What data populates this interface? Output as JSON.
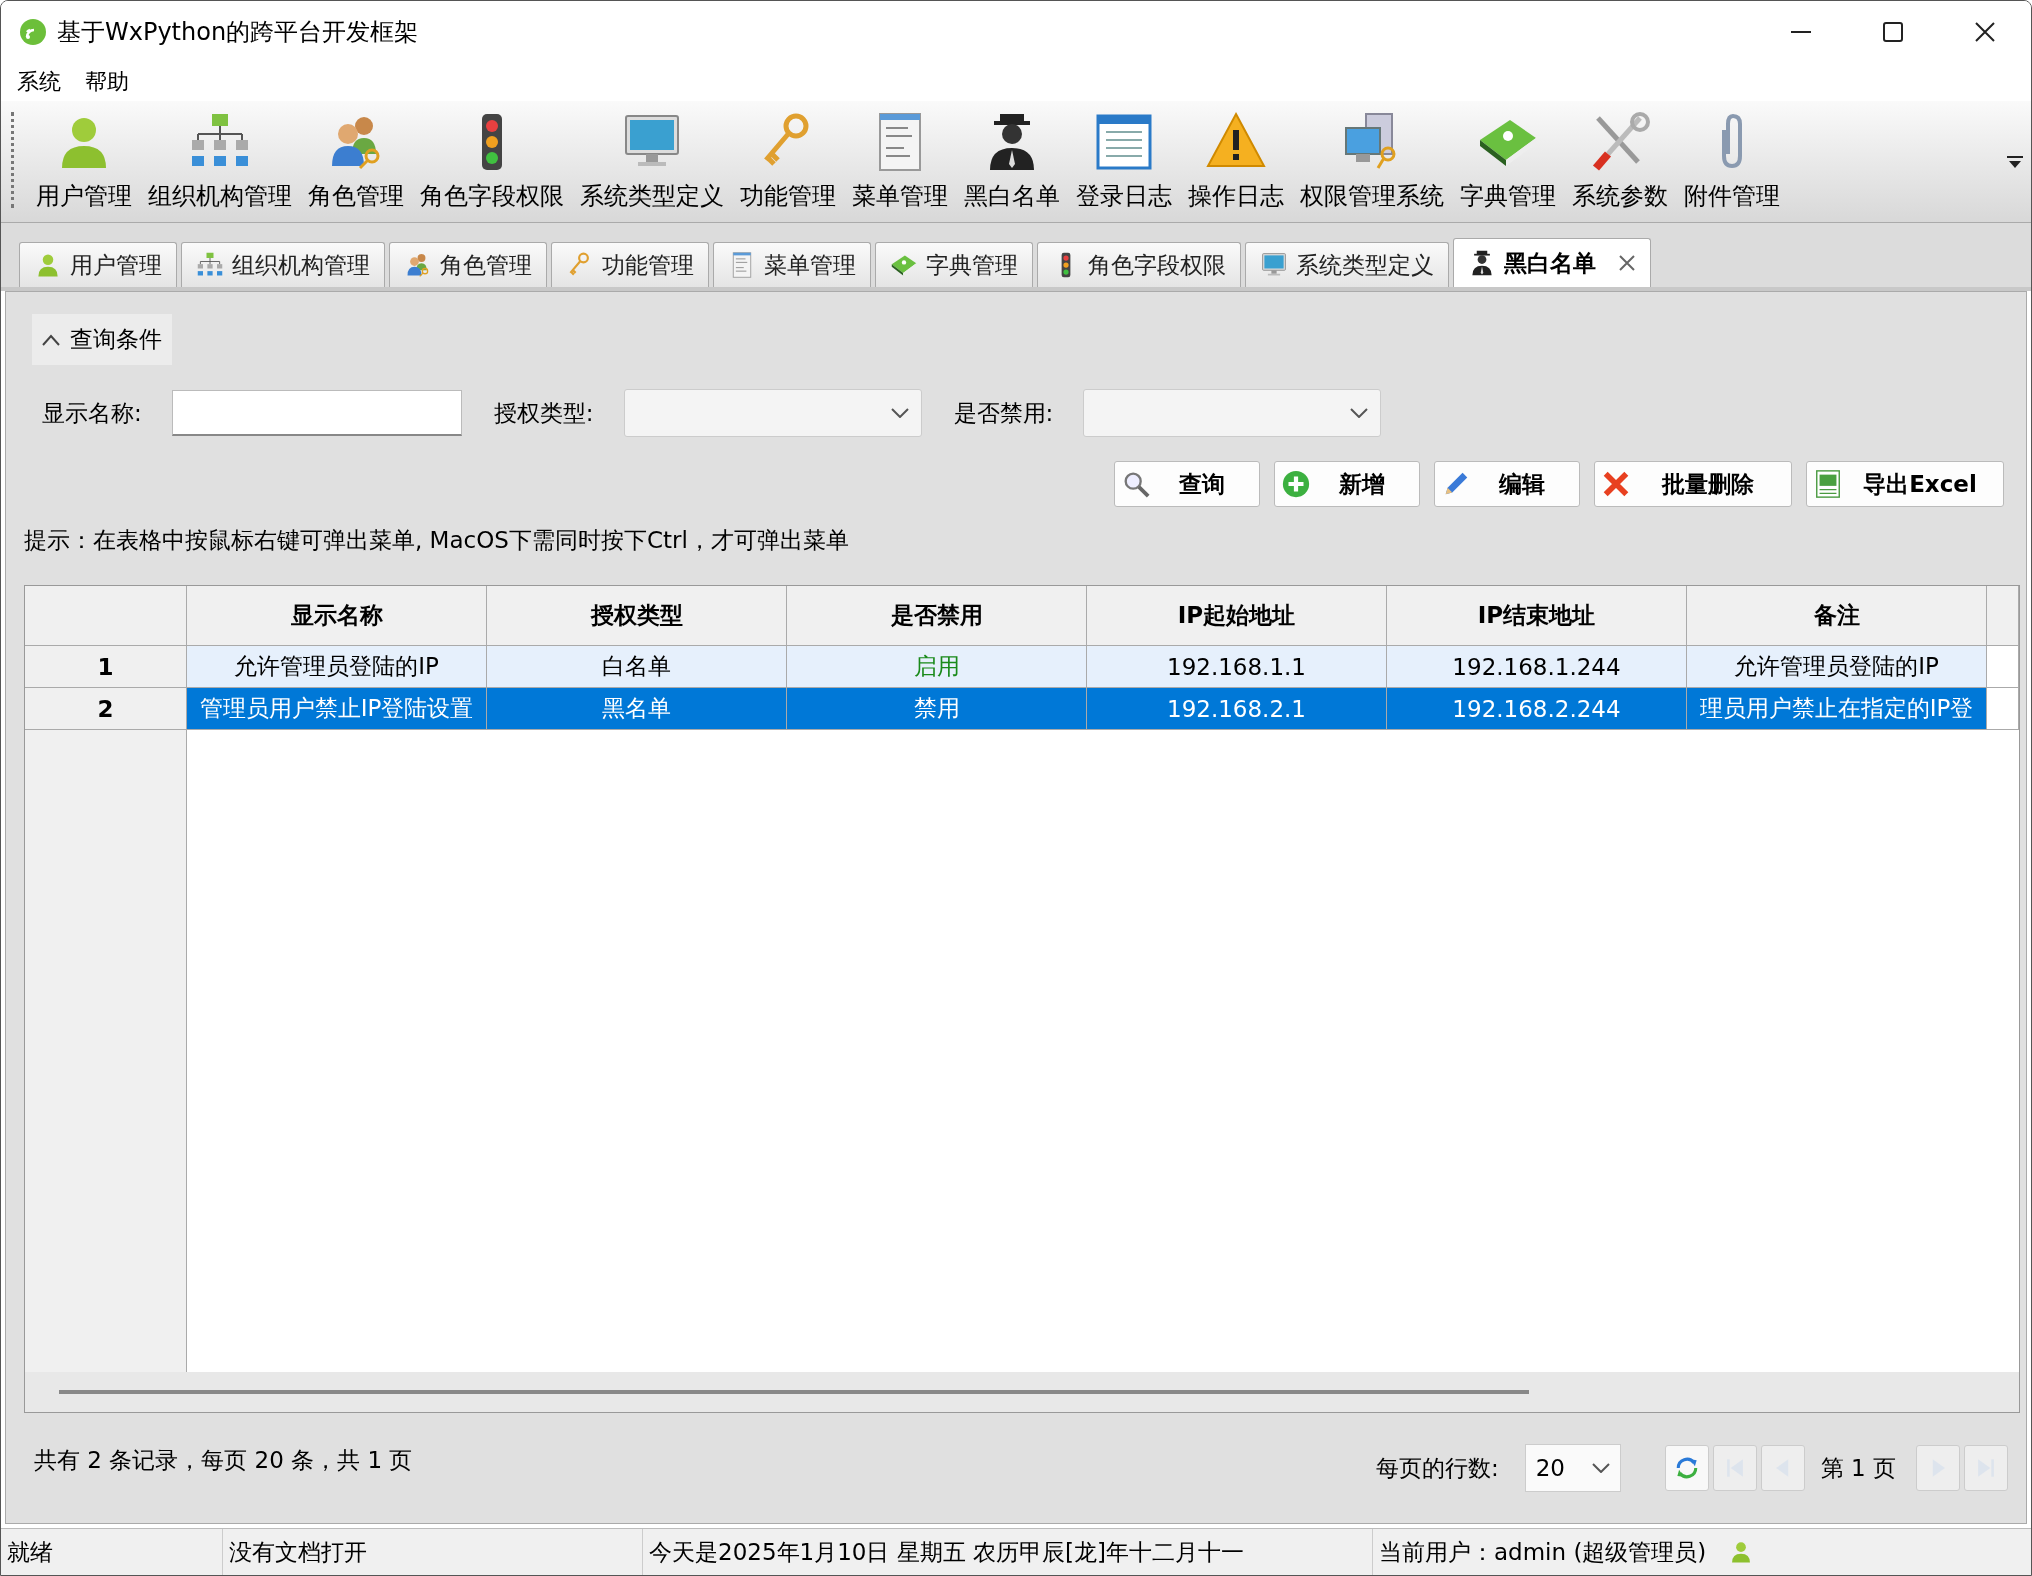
{
  "window": {
    "title": "基于WxPython的跨平台开发框架"
  },
  "menu": [
    "系统",
    "帮助"
  ],
  "toolbar": [
    {
      "label": "用户管理",
      "kind": "user"
    },
    {
      "label": "组织机构管理",
      "kind": "org"
    },
    {
      "label": "角色管理",
      "kind": "roles"
    },
    {
      "label": "角色字段权限",
      "kind": "traffic"
    },
    {
      "label": "系统类型定义",
      "kind": "monitor"
    },
    {
      "label": "功能管理",
      "kind": "keys"
    },
    {
      "label": "菜单管理",
      "kind": "menu"
    },
    {
      "label": "黑白名单",
      "kind": "agent"
    },
    {
      "label": "登录日志",
      "kind": "log"
    },
    {
      "label": "操作日志",
      "kind": "warning"
    },
    {
      "label": "权限管理系统",
      "kind": "computers"
    },
    {
      "label": "字典管理",
      "kind": "book"
    },
    {
      "label": "系统参数",
      "kind": "tools"
    },
    {
      "label": "附件管理",
      "kind": "clip"
    }
  ],
  "tabs": [
    {
      "label": "用户管理",
      "kind": "user",
      "selected": false,
      "closable": false
    },
    {
      "label": "组织机构管理",
      "kind": "org",
      "selected": false,
      "closable": false
    },
    {
      "label": "角色管理",
      "kind": "roles",
      "selected": false,
      "closable": false
    },
    {
      "label": "功能管理",
      "kind": "keys",
      "selected": false,
      "closable": false
    },
    {
      "label": "菜单管理",
      "kind": "menu",
      "selected": false,
      "closable": false
    },
    {
      "label": "字典管理",
      "kind": "book",
      "selected": false,
      "closable": false
    },
    {
      "label": "角色字段权限",
      "kind": "traffic",
      "selected": false,
      "closable": false
    },
    {
      "label": "系统类型定义",
      "kind": "monitor",
      "selected": false,
      "closable": false
    },
    {
      "label": "黑白名单",
      "kind": "agent",
      "selected": true,
      "closable": true
    }
  ],
  "query": {
    "title": "查询条件",
    "expanded": true,
    "fields": [
      {
        "kind": "text",
        "label": "显示名称:"
      },
      {
        "kind": "select",
        "label": "授权类型:"
      },
      {
        "kind": "select",
        "label": "是否禁用:"
      }
    ],
    "buttons": [
      {
        "label": "查询",
        "kind": "search"
      },
      {
        "label": "新增",
        "kind": "add"
      },
      {
        "label": "编辑",
        "kind": "edit"
      },
      {
        "label": "批量删除",
        "kind": "delete"
      },
      {
        "label": "导出Excel",
        "kind": "excel"
      }
    ]
  },
  "hint": "提示：在表格中按鼠标右键可弹出菜单, MacOS下需同时按下Ctrl，才可弹出菜单",
  "table": {
    "columns": [
      "显示名称",
      "授权类型",
      "是否禁用",
      "IP起始地址",
      "IP结束地址",
      "备注"
    ],
    "rows": [
      {
        "index": "1",
        "selected": false,
        "enabled": true,
        "cells": [
          "允许管理员登陆的IP",
          "白名单",
          "启用",
          "192.168.1.1",
          "192.168.1.244",
          "允许管理员登陆的IP"
        ]
      },
      {
        "index": "2",
        "selected": true,
        "enabled": false,
        "cells": [
          "管理员用户禁止IP登陆设置",
          "黑名单",
          "禁用",
          "192.168.2.1",
          "192.168.2.244",
          "理员用户禁止在指定的IP登"
        ]
      }
    ]
  },
  "pager": {
    "summary": "共有 2 条记录，每页 20 条，共 1 页",
    "rows_label": "每页的行数:",
    "rows_value": "20",
    "page_label": "第 1 页",
    "nav": [
      {
        "kind": "refresh",
        "disabled": false
      },
      {
        "kind": "first",
        "disabled": true
      },
      {
        "kind": "prev",
        "disabled": true
      },
      {
        "kind": "next",
        "disabled": true
      },
      {
        "kind": "last",
        "disabled": true
      }
    ]
  },
  "status_bar": [
    "就绪",
    "没有文档打开",
    "今天是2025年1月10日 星期五 农历甲辰[龙]年十二月十一",
    "当前用户：admin (超级管理员)"
  ]
}
